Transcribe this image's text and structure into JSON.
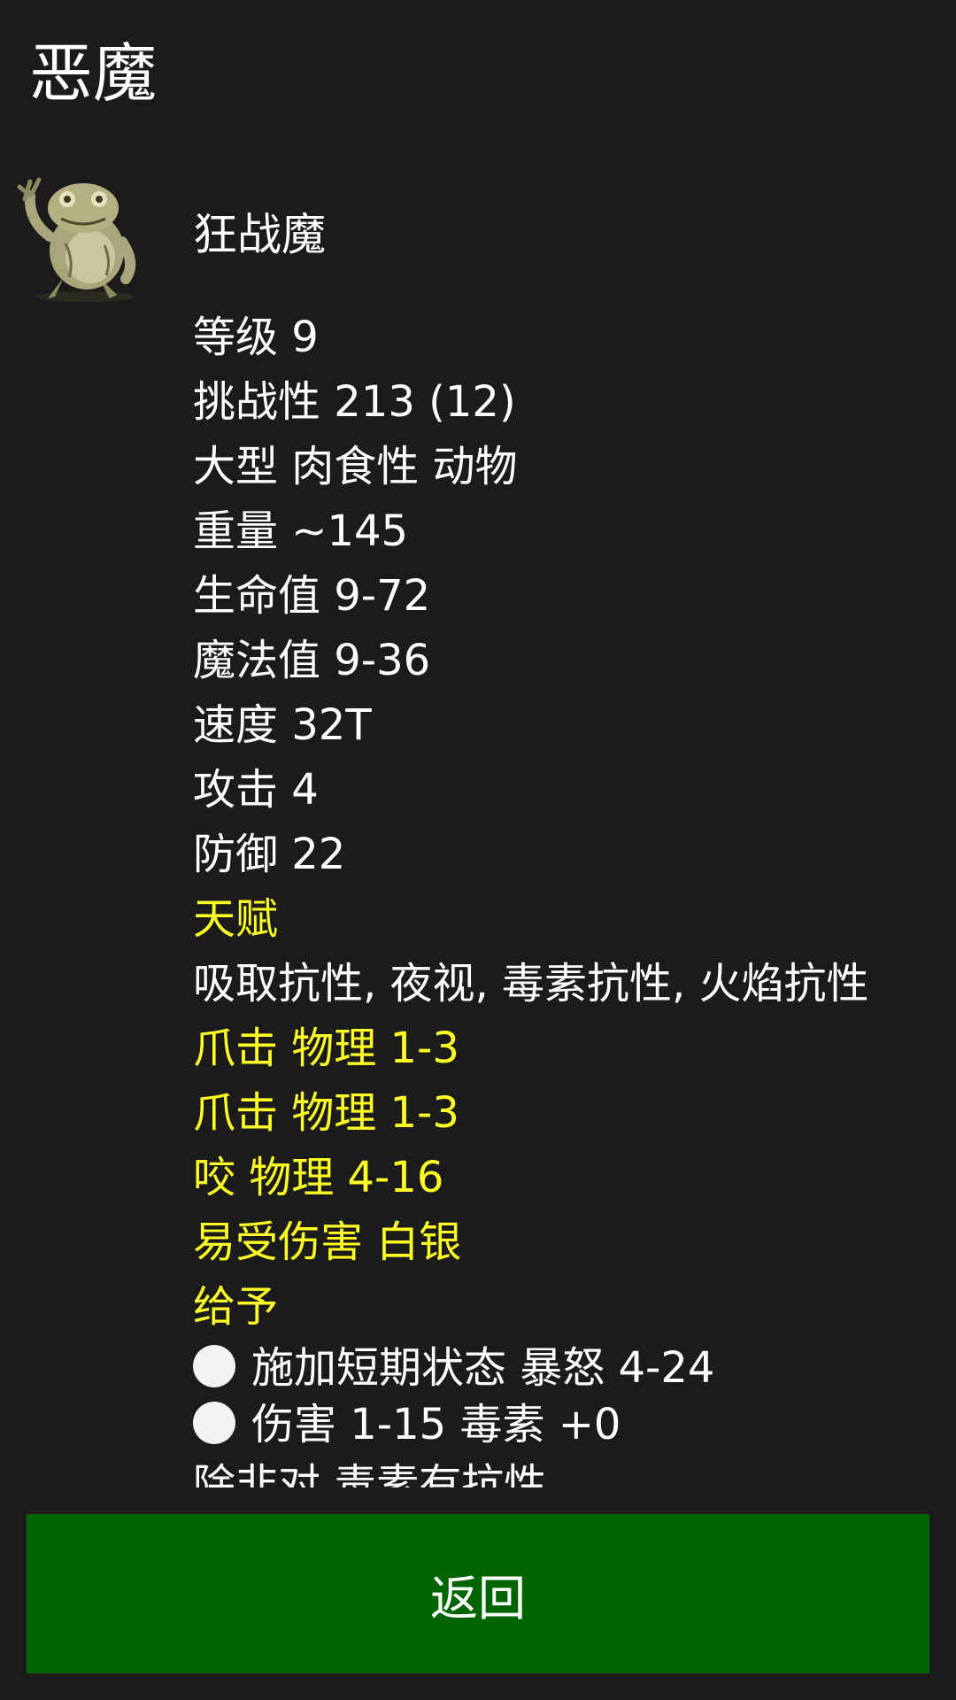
{
  "header": {
    "title": "恶魔"
  },
  "monster": {
    "icon": "toad-demon-icon",
    "name": "狂战魔",
    "stats": [
      {
        "text": "等级 9",
        "color": "white"
      },
      {
        "text": "挑战性 213 (12)",
        "color": "white"
      },
      {
        "text": "大型 肉食性 动物",
        "color": "white"
      },
      {
        "text": "重量 ~145",
        "color": "white"
      },
      {
        "text": "生命值 9-72",
        "color": "white"
      },
      {
        "text": "魔法值 9-36",
        "color": "white"
      },
      {
        "text": "速度 32T",
        "color": "white"
      },
      {
        "text": "攻击 4",
        "color": "white"
      },
      {
        "text": "防御 22",
        "color": "white"
      },
      {
        "text": "天赋",
        "color": "yellow"
      },
      {
        "text": "吸取抗性, 夜视, 毒素抗性, 火焰抗性",
        "color": "white"
      },
      {
        "text": "爪击 物理 1-3",
        "color": "yellow"
      },
      {
        "text": "爪击 物理 1-3",
        "color": "yellow"
      },
      {
        "text": "咬 物理 4-16",
        "color": "yellow"
      },
      {
        "text": "易受伤害 白银",
        "color": "yellow"
      },
      {
        "text": "给予",
        "color": "yellow"
      }
    ],
    "effects": [
      "施加短期状态 暴怒 4-24",
      "伤害 1-15 毒素 +0",
      "除非对 毒素有抗性"
    ]
  },
  "footer": {
    "back_label": "返回",
    "back_color": "#006400"
  },
  "colors": {
    "background": "#1b1b1b",
    "highlight": "#ffff26"
  }
}
